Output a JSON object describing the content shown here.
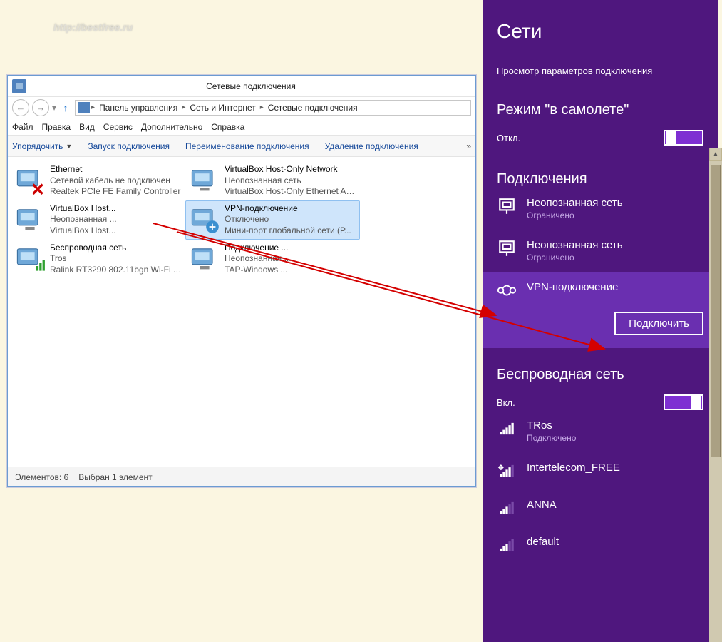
{
  "watermark": "http://bestfree.ru",
  "explorer": {
    "title": "Сетевые подключения",
    "breadcrumbs": [
      "Панель управления",
      "Сеть и Интернет",
      "Сетевые подключения"
    ],
    "menus": [
      "Файл",
      "Правка",
      "Вид",
      "Сервис",
      "Дополнительно",
      "Справка"
    ],
    "toolbar": {
      "organize": "Упорядочить",
      "start": "Запуск подключения",
      "rename": "Переименование подключения",
      "delete": "Удаление подключения"
    },
    "connections": [
      {
        "name": "Ethernet",
        "line1": "Сетевой кабель не подключен",
        "line2": "Realtek PCIe FE Family Controller",
        "icon": "eth-x"
      },
      {
        "name": "VirtualBox Host-Only Network",
        "line1": "Неопознанная сеть",
        "line2": "VirtualBox Host-Only Ethernet Ad...",
        "icon": "eth"
      },
      {
        "name": "VirtualBox Host...",
        "line1": "Неопознанная ...",
        "line2": "VirtualBox Host...",
        "icon": "eth"
      },
      {
        "name": "VPN-подключение",
        "line1": "Отключено",
        "line2": "Мини-порт глобальной сети (Р...",
        "icon": "vpn",
        "selected": true
      },
      {
        "name": "Беспроводная сеть",
        "line1": "Tros",
        "line2": "Ralink RT3290 802.11bgn Wi-Fi A...",
        "icon": "wifi"
      },
      {
        "name": "Подключение ...",
        "line1": "Неопознанная ...",
        "line2": "TAP-Windows ...",
        "icon": "eth"
      }
    ],
    "status": {
      "count": "Элементов: 6",
      "selected": "Выбран 1 элемент"
    }
  },
  "charms": {
    "title": "Сети",
    "settings_link": "Просмотр параметров подключения",
    "airplane": {
      "title": "Режим \"в самолете\"",
      "state": "Откл."
    },
    "connections_title": "Подключения",
    "conn_list": [
      {
        "name": "Неопознанная сеть",
        "sub": "Ограничено",
        "icon": "eth"
      },
      {
        "name": "Неопознанная сеть",
        "sub": "Ограничено",
        "icon": "eth"
      },
      {
        "name": "VPN-подключение",
        "sub": "",
        "icon": "vpn",
        "selected": true
      }
    ],
    "connect_btn": "Подключить",
    "wifi": {
      "title": "Беспроводная сеть",
      "state": "Вкл."
    },
    "wifi_list": [
      {
        "name": "TRos",
        "sub": "Подключено",
        "bars": 5
      },
      {
        "name": "Intertelecom_FREE",
        "sub": "",
        "bars": 4,
        "shield": true
      },
      {
        "name": "ANNA",
        "sub": "",
        "bars": 3
      },
      {
        "name": "default",
        "sub": "",
        "bars": 3
      }
    ]
  }
}
